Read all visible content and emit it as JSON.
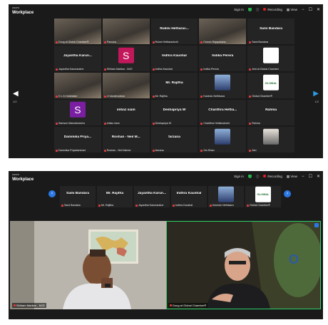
{
  "app": {
    "brand_small": "zoom",
    "brand": "Workplace"
  },
  "titlebar": {
    "sign_in": "Sign in",
    "recording": "Recording",
    "view": "View"
  },
  "gallery": {
    "page_left": "1/2",
    "page_right": "1/2",
    "tiles": [
      {
        "name": "",
        "label": "Doug at Global Chamber®",
        "kind": "video",
        "active": true
      },
      {
        "name": "",
        "label": "Pamuka",
        "kind": "video"
      },
      {
        "name": "Rukmi Hettiarac...",
        "label": "Rukmi Hettiarachchi",
        "kind": "name"
      },
      {
        "name": "",
        "label": "Dinesh Rajapaksha",
        "kind": "video"
      },
      {
        "name": "Sami Bandara",
        "label": "Sami Bandara",
        "kind": "name"
      },
      {
        "name": "Jayantha Karun...",
        "label": "Jayantha Karunaratne",
        "kind": "name"
      },
      {
        "name": "",
        "label": "Shiham Marikar - NCE",
        "kind": "letter",
        "letter": "S",
        "color": "#c2185b"
      },
      {
        "name": "Indhra Kaushal",
        "label": "Indhra Kaushal",
        "kind": "name"
      },
      {
        "name": "Indika Perera",
        "label": "Indika Perera",
        "kind": "name"
      },
      {
        "name": "",
        "label": "Jeni at Global Chamber",
        "kind": "logo"
      },
      {
        "name": "",
        "label": "D L Kr Notetaker",
        "kind": "video"
      },
      {
        "name": "",
        "label": "Ji Vandercoinan",
        "kind": "video"
      },
      {
        "name": "Mr. Rajitha",
        "label": "Mr. Rajitha",
        "kind": "name"
      },
      {
        "name": "",
        "label": "Kavindu Nethtsara",
        "kind": "photo"
      },
      {
        "name": "",
        "label": "Global Chamber®",
        "kind": "logo2",
        "logo_text": "GLOBAL"
      },
      {
        "name": "",
        "label": "Samson Manufacturers",
        "kind": "letter",
        "letter": "S",
        "color": "#7b1fa2"
      },
      {
        "name": "imtiaz siam",
        "label": "imtiaz siam",
        "kind": "name"
      },
      {
        "name": "Deshapriya W",
        "label": "Deshapriya W",
        "kind": "name"
      },
      {
        "name": "Charithra Hettia...",
        "label": "Charithra Hettiarachchi",
        "kind": "name"
      },
      {
        "name": "Rahma",
        "label": "Rahma",
        "kind": "name"
      },
      {
        "name": "Dammika Priya...",
        "label": "Dammika Priyadarshani",
        "kind": "name"
      },
      {
        "name": "Roshan - Neil M...",
        "label": "Roshan - Neil Marine",
        "kind": "name"
      },
      {
        "name": "farzana",
        "label": "farzana",
        "kind": "name"
      },
      {
        "name": "",
        "label": "Om Bhan",
        "kind": "photo"
      },
      {
        "name": "",
        "label": "Zari",
        "kind": "photo2"
      }
    ]
  },
  "speaker_view": {
    "strip": [
      {
        "name": "Sami Bandara",
        "label": "Sami Bandara",
        "kind": "name"
      },
      {
        "name": "Mr. Rajitha",
        "label": "Mr. Rajitha",
        "kind": "name"
      },
      {
        "name": "Jayantha Karun...",
        "label": "Jayantha Karunaratne",
        "kind": "name"
      },
      {
        "name": "Indhra Kaushal",
        "label": "Indhra Kaushal",
        "kind": "name"
      },
      {
        "name": "",
        "label": "Kavindu Nethtsara",
        "kind": "photo"
      },
      {
        "name": "",
        "label": "Global Chamber®",
        "kind": "logo2",
        "logo_text": "GLOBAL"
      }
    ],
    "main_left_label": "Shiham Marikar - NCE",
    "main_right_label": "Doug at Global Chamber®"
  }
}
